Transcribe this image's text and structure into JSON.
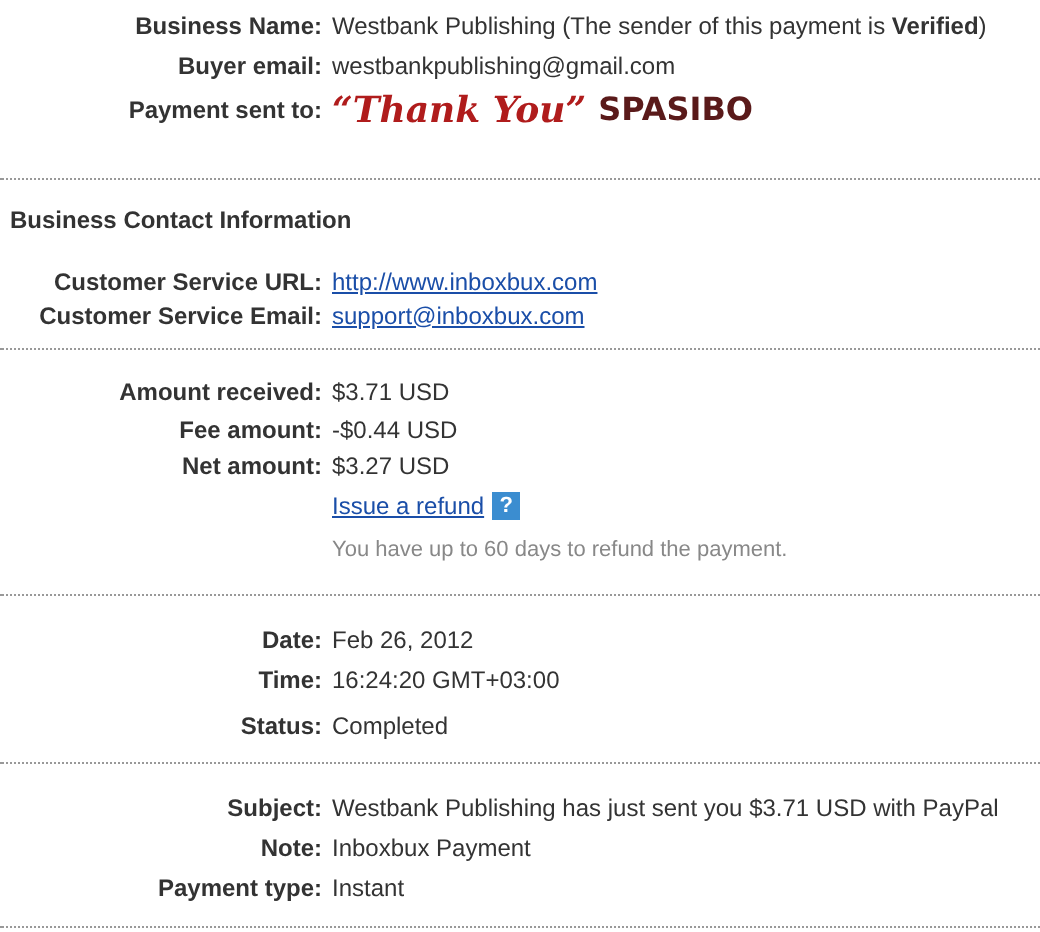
{
  "sections": [
    {
      "rows": [
        {
          "label": "Business Name:",
          "value": "Westbank Publishing (The sender of this payment is **Verified**)"
        },
        {
          "label": "Buyer email:",
          "value": "westbankpublishing@gmail.com"
        },
        {
          "label": "Payment sent to:",
          "value": "“Thank You”",
          "value_2": "SPASIBO",
          "kind": "stylized"
        }
      ]
    },
    {
      "heading": "Business Contact Information",
      "rows": [
        {
          "label": "Customer Service URL:",
          "value": "http://www.inboxbux.com",
          "kind": "link"
        },
        {
          "label": "Customer Service Email:",
          "value": "support@inboxbux.com",
          "kind": "link"
        }
      ]
    },
    {
      "rows": [
        {
          "label": "Amount received:",
          "value": "$3.71 USD"
        },
        {
          "label": "Fee amount:",
          "value": "-$0.44 USD"
        },
        {
          "label": "Net amount:",
          "value": "$3.27 USD"
        }
      ],
      "refund": {
        "link": "Issue a refund",
        "help": "?",
        "note": "You have up to 60 days to refund the payment."
      }
    },
    {
      "rows": [
        {
          "label": "Date:",
          "value": "Feb 26, 2012"
        },
        {
          "label": "Time:",
          "value": "16:24:20 GMT+03:00"
        },
        {
          "label": "Status:",
          "value": "Completed"
        }
      ]
    },
    {
      "rows": [
        {
          "label": "Subject:",
          "value": "Westbank Publishing has just sent you $3.71 USD with PayPal"
        },
        {
          "label": "Note:",
          "value": "Inboxbux Payment"
        },
        {
          "label": "Payment type:",
          "value": "Instant"
        }
      ]
    }
  ]
}
